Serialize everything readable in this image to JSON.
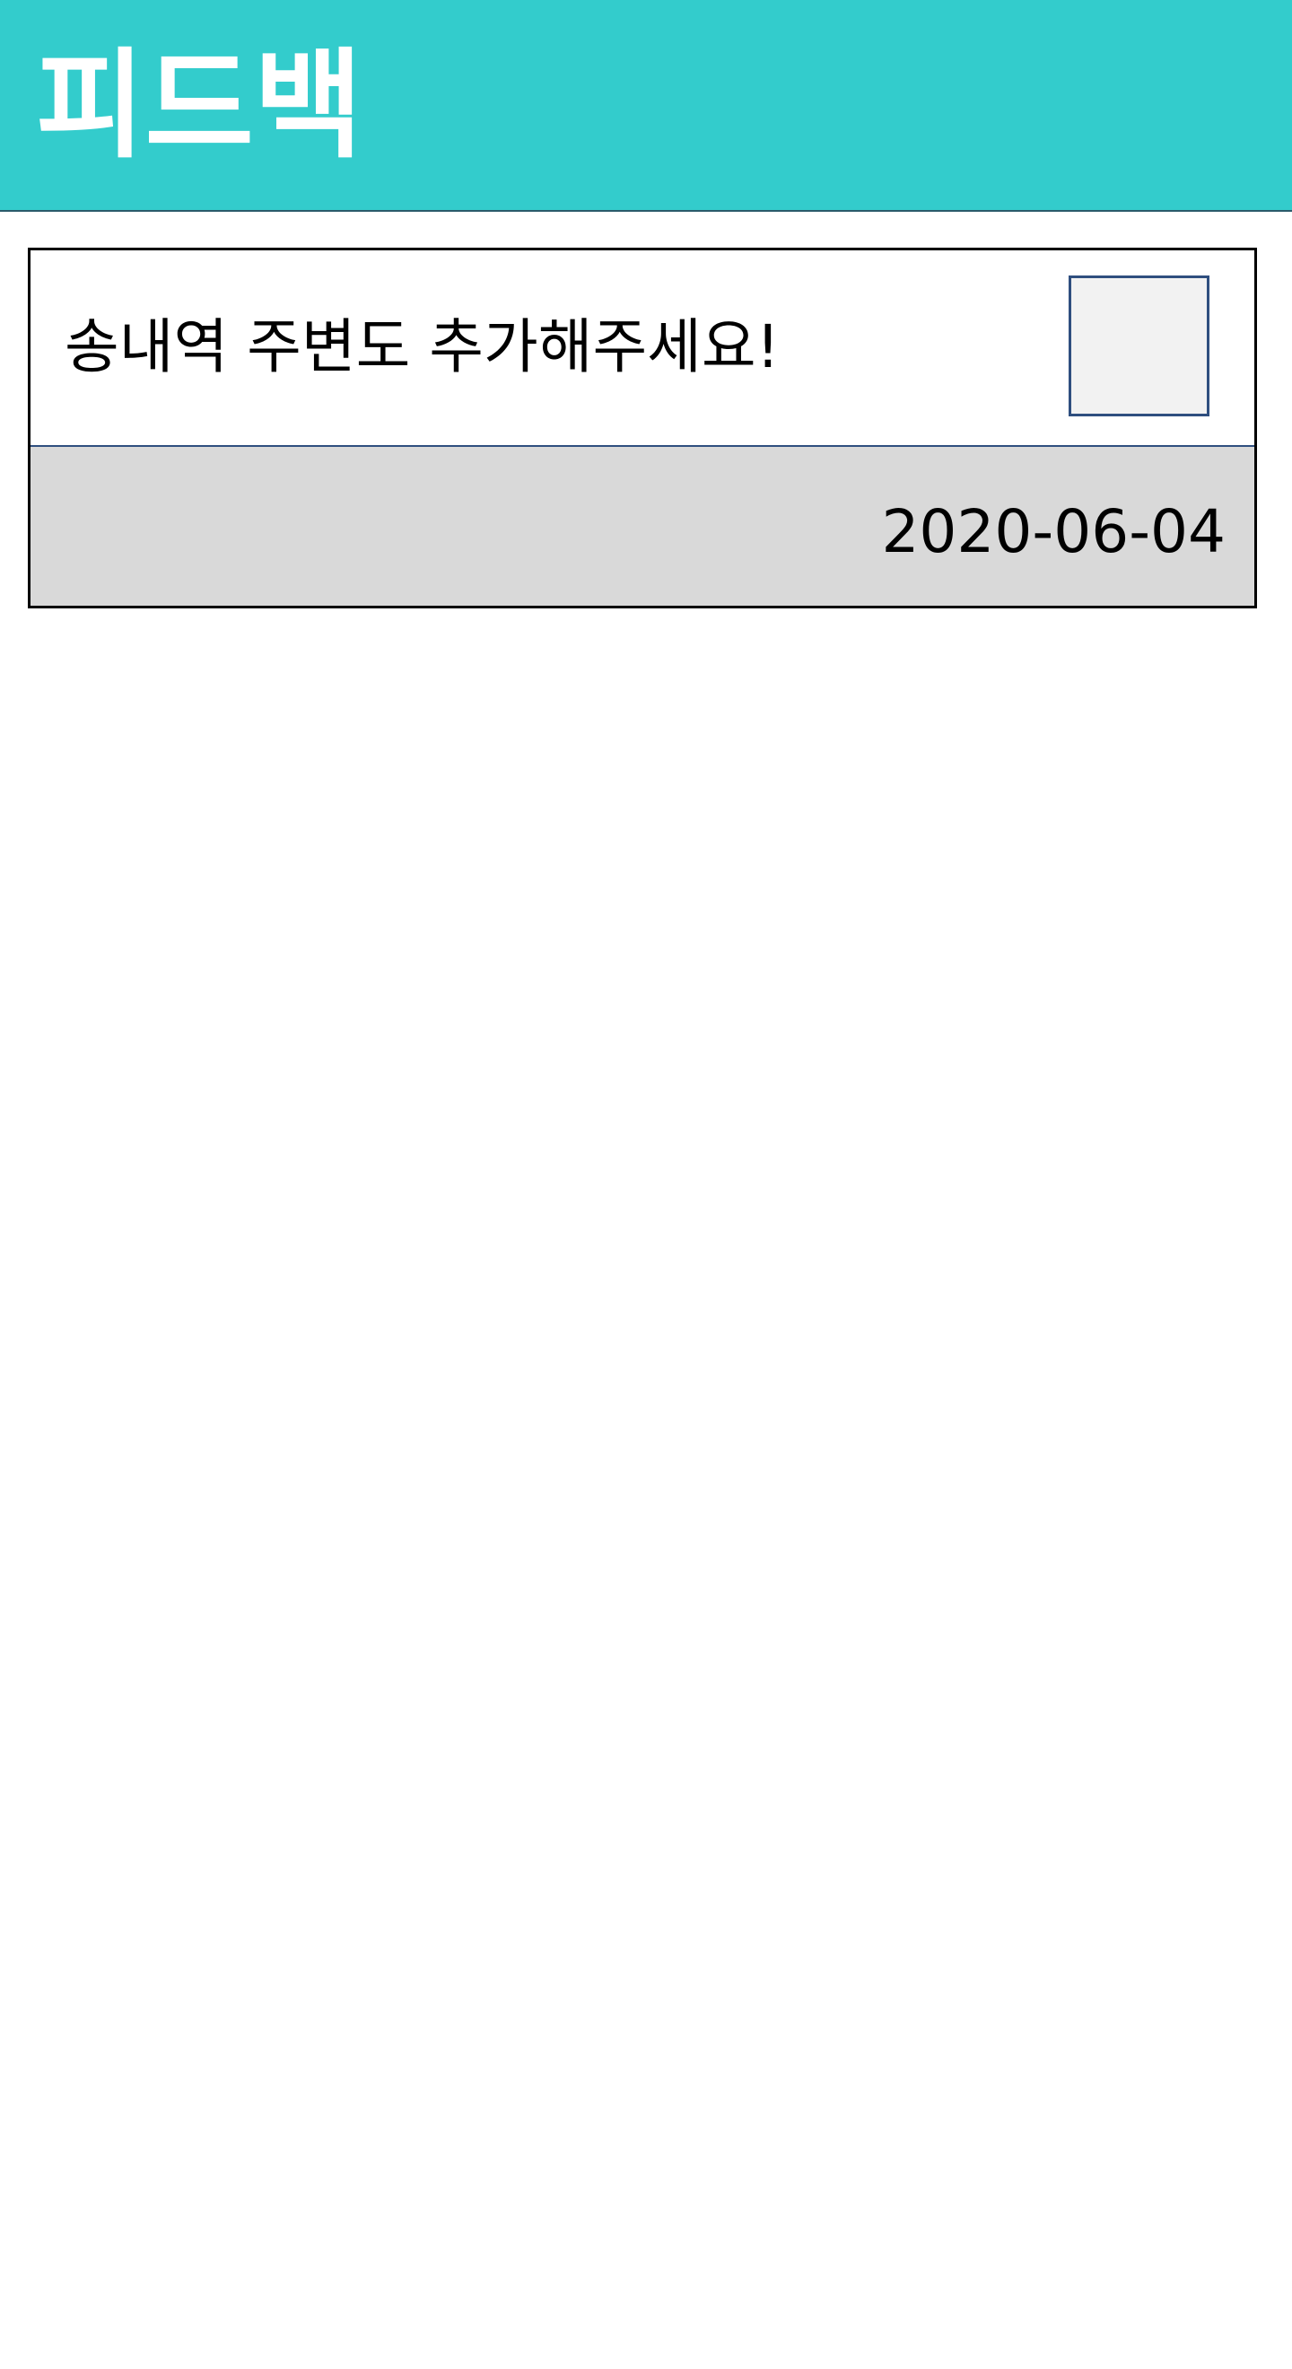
{
  "header": {
    "title": "피드백",
    "background_color": "#33CCCC",
    "text_color": "#FFFFFF"
  },
  "feedback_list": [
    {
      "message": "송내역 주변도 추가해주세요!",
      "date": "2020-06-04",
      "checked": false
    }
  ],
  "colors": {
    "card_footer": "#D9D9D9",
    "checkbox_fill": "#F2F2F2",
    "checkbox_border": "#2F4F7F"
  }
}
